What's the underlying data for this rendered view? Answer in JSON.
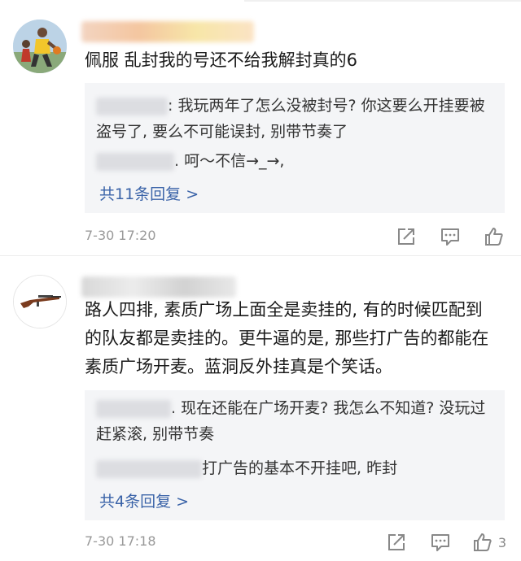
{
  "comments": [
    {
      "text": "佩服 乱封我的号还不给我解封真的6",
      "replies": [
        {
          "text": ": 我玩两年了怎么没被封号? 你这要么开挂要被盗号了, 要么不可能误封, 别带节奏了"
        },
        {
          "text": ". 呵～不信→_→,"
        }
      ],
      "reply_link": "共11条回复 >",
      "time": "7-30 17:20",
      "like_count": ""
    },
    {
      "text": "路人四排, 素质广场上面全是卖挂的, 有的时候匹配到的队友都是卖挂的。更牛逼的是, 那些打广告的都能在素质广场开麦。蓝洞反外挂真是个笑话。",
      "replies": [
        {
          "text": ". 现在还能在广场开麦? 我怎么不知道? 没玩过赶紧滚, 别带节奏"
        },
        {
          "text": "打广告的基本不开挂吧, 昨封"
        }
      ],
      "reply_link": "共4条回复 >",
      "time": "7-30 17:18",
      "like_count": "3"
    }
  ],
  "icons": {
    "share": "share-icon",
    "comment": "comment-icon",
    "like": "thumbs-up-icon"
  },
  "colors": {
    "link": "#3a63a8",
    "meta": "#999999",
    "reply_bg": "#f4f5f7"
  }
}
